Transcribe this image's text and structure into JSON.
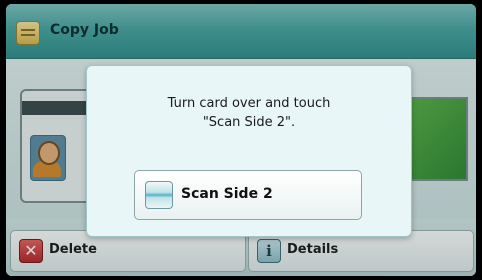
{
  "header": {
    "title": "Copy Job",
    "icon": "copy-job-icon"
  },
  "dialog": {
    "message_line1": "Turn card over and touch",
    "message_line2": "\"Scan Side 2\".",
    "button_label": "Scan Side 2",
    "button_icon": "scan-icon"
  },
  "footer": {
    "delete_label": "Delete",
    "delete_icon": "delete-x-icon",
    "details_label": "Details",
    "details_icon": "info-icon"
  },
  "colors": {
    "titlebar": "#4aa7a4",
    "dialog_bg": "#e8f6f7",
    "delete_red": "#b8262a"
  }
}
